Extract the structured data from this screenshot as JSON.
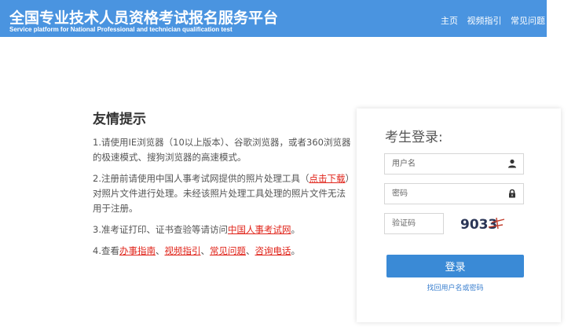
{
  "header": {
    "title": "全国专业技术人员资格考试报名服务平台",
    "subtitle": "Service platform for National Professional and technician qualification test",
    "nav": [
      "主页",
      "视频指引",
      "常见问题"
    ],
    "background": "#4a94e0"
  },
  "tips": {
    "title": "友情提示",
    "item1": "1.请使用IE浏览器（10以上版本）、谷歌浏览器，或者360浏览器的极速模式、搜狗浏览器的高速模式。",
    "item2_before": "2.注册前请使用中国人事考试网提供的照片处理工具（",
    "item2_link": "点击下载",
    "item2_after": "）对照片文件进行处理。未经该照片处理工具处理的照片文件无法用于注册。",
    "item3_before": "3.准考证打印、证书查验等请访问",
    "item3_link": "中国人事考试网",
    "item3_after": "。",
    "item4_before": "4.查看",
    "item4_links": [
      "办事指南",
      "视频指引",
      "常见问题",
      "咨询电话"
    ],
    "item4_sep": "、",
    "item4_after": "。",
    "link_color": "#e0241a"
  },
  "login": {
    "title": "考生登录:",
    "username_placeholder": "用户名",
    "password_placeholder": "密码",
    "captcha_placeholder": "验证码",
    "captcha_text": "9033",
    "button_label": "登录",
    "forgot_link": "找回用户名或密码",
    "button_color": "#3a8ad6",
    "icons": {
      "username": "user-icon",
      "password": "lock-icon"
    }
  }
}
